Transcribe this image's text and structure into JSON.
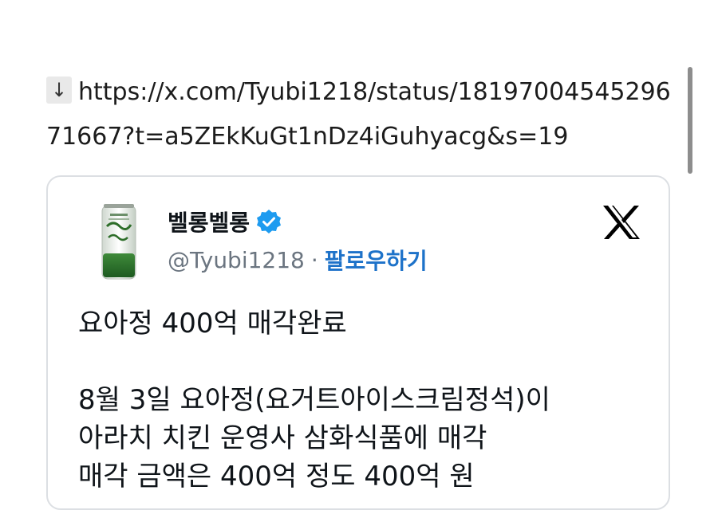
{
  "share": {
    "arrow_icon": "↓",
    "url": "https://x.com/Tyubi1218/status/1819700454529671667?t=a5ZEkKuGt1nDz4iGuhyacg&s=19"
  },
  "tweet": {
    "display_name": "벨롱벨롱",
    "handle": "@Tyubi1218",
    "separator": "·",
    "follow_label": "팔로우하기",
    "avatar_icon": "drink-can-avatar",
    "verified_icon": "verified-badge-icon",
    "platform_icon": "x-logo-icon",
    "lines": [
      "요아정 400억 매각완료",
      "8월 3일 요아정(요거트아이스크림정석)이",
      "아라치 치킨 운영사 삼화식품에 매각",
      "매각 금액은 400억 정도 400억 원"
    ]
  },
  "colors": {
    "follow": "#1d72c9",
    "verified": "#1d9bf0",
    "card_border": "#dcdfe3"
  }
}
